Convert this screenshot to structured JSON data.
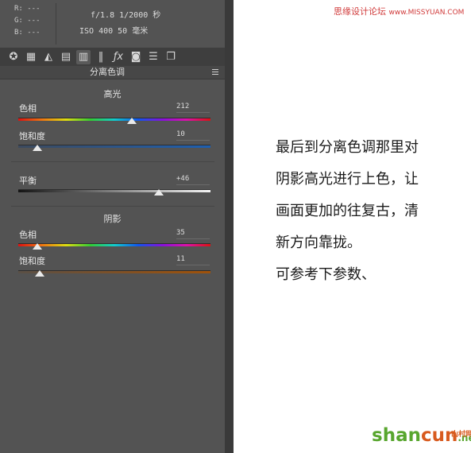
{
  "info": {
    "rgb": [
      "R: ---",
      "G: ---",
      "B: ---"
    ],
    "exif_line1": "f/1.8  1/2000 秒",
    "exif_line2": "ISO 400  50 毫米"
  },
  "toolbar": {
    "tabs": [
      {
        "icon": "aperture-icon",
        "glyph": "✪"
      },
      {
        "icon": "histogram-grid-icon",
        "glyph": "▦"
      },
      {
        "icon": "tone-curve-icon",
        "glyph": "◭"
      },
      {
        "icon": "hsl-icon",
        "glyph": "▤"
      },
      {
        "icon": "split-toning-icon",
        "glyph": "▥",
        "active": true
      },
      {
        "icon": "lens-icon",
        "glyph": "‖"
      },
      {
        "icon": "effects-fx-icon",
        "glyph": "ƒx"
      },
      {
        "icon": "camera-calibration-icon",
        "glyph": "◙"
      },
      {
        "icon": "presets-sliders-icon",
        "glyph": "☰"
      },
      {
        "icon": "snapshots-icon",
        "glyph": "❐"
      }
    ]
  },
  "panel": {
    "title": "分离色调",
    "highlights": {
      "title": "高光",
      "hue_label": "色相",
      "hue_value": "212",
      "hue_level": 212,
      "hue_max": 360,
      "sat_label": "饱和度",
      "sat_value": "10",
      "sat_level": 10,
      "sat_max": 100
    },
    "balance": {
      "label": "平衡",
      "value": "+46",
      "level": 46,
      "min": -100,
      "max": 100
    },
    "shadows": {
      "title": "阴影",
      "hue_label": "色相",
      "hue_value": "35",
      "hue_level": 35,
      "hue_max": 360,
      "sat_label": "饱和度",
      "sat_value": "11",
      "sat_level": 11,
      "sat_max": 100
    }
  },
  "note_lines": [
    "最后到分离色调那里对",
    "阴影高光进行上色，让",
    "画面更加的往复古，清",
    "新方向靠拢。",
    "可参考下参数、"
  ],
  "watermark_top": {
    "text": "思缘设计论坛",
    "domain": "www.MISSYUAN.COM"
  },
  "watermark_bottom": {
    "shan": "shan",
    "cun": "cun",
    "net": ".net",
    "cn": "山村网"
  }
}
